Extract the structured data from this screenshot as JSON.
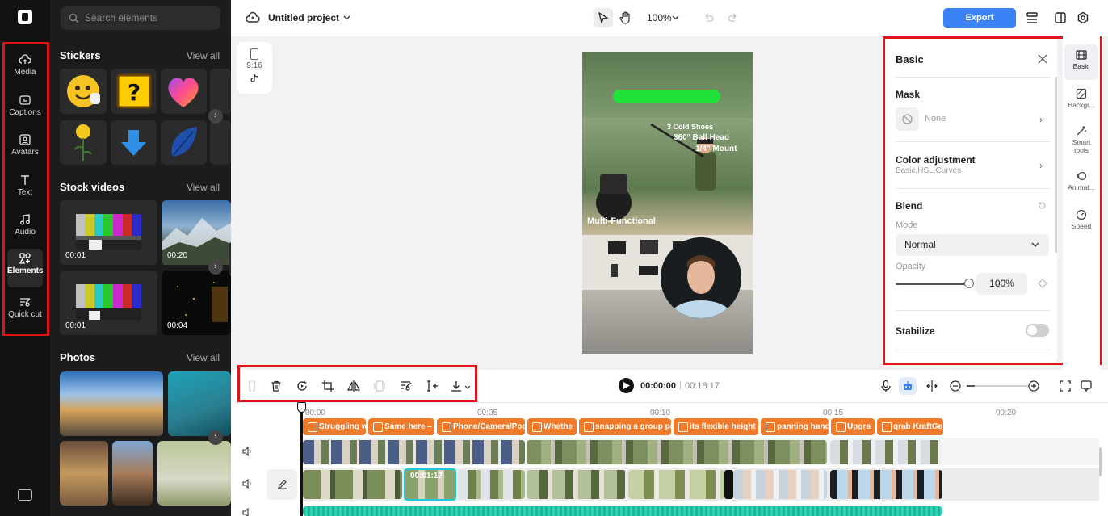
{
  "rail": {
    "items": [
      {
        "label": "Media",
        "icon": "cloud-upload-icon"
      },
      {
        "label": "Captions",
        "icon": "captions-icon"
      },
      {
        "label": "Avatars",
        "icon": "avatar-icon"
      },
      {
        "label": "Text",
        "icon": "text-icon"
      },
      {
        "label": "Audio",
        "icon": "music-note-icon"
      },
      {
        "label": "Elements",
        "icon": "elements-icon"
      },
      {
        "label": "Quick cut",
        "icon": "quick-cut-icon"
      }
    ],
    "active": "Elements"
  },
  "panel": {
    "search_placeholder": "Search elements",
    "stickers": {
      "title": "Stickers",
      "view_all": "View all"
    },
    "stock_videos": {
      "title": "Stock videos",
      "view_all": "View all",
      "durations": [
        "00:01",
        "00:20",
        "00:01",
        "00:04"
      ]
    },
    "photos": {
      "title": "Photos",
      "view_all": "View all"
    }
  },
  "header": {
    "project_name": "Untitled project",
    "zoom": "100%",
    "export_label": "Export"
  },
  "canvas": {
    "ratio": "9:16",
    "video_text": {
      "line1": "3 Cold Shoes",
      "line2": "360° Ball Head",
      "line3": "1/4\" Mount",
      "tagline": "Multi-Functional"
    }
  },
  "props": {
    "title": "Basic",
    "mask": {
      "label": "Mask",
      "value": "None"
    },
    "color": {
      "label": "Color adjustment",
      "sub": "Basic,HSL,Curves"
    },
    "blend": {
      "label": "Blend",
      "mode_label": "Mode",
      "mode_value": "Normal",
      "opacity_label": "Opacity",
      "opacity_value": "100%"
    },
    "stabilize": {
      "label": "Stabilize"
    }
  },
  "right_tabs": [
    {
      "label": "Basic",
      "icon": "film-icon"
    },
    {
      "label": "Backgr...",
      "icon": "background-icon"
    },
    {
      "label": "Smart tools",
      "icon": "magic-wand-icon"
    },
    {
      "label": "Animat...",
      "icon": "animation-icon"
    },
    {
      "label": "Speed",
      "icon": "speed-icon"
    }
  ],
  "toolbar": {
    "current_time": "00:00:00",
    "total_time": "00:18:17"
  },
  "timeline": {
    "ruler": [
      "00:00",
      "00:05",
      "00:10",
      "00:15",
      "00:20"
    ],
    "captions": [
      "Struggling w",
      "Same here –",
      "Phone/Camera/Pod",
      "Whethe",
      "snapping a group pi",
      "its flexible height",
      "panning hand",
      "Upgra",
      "grab KraftGe"
    ],
    "selected_clip_time": "00:01:17"
  },
  "colors": {
    "accent": "#3b82f6",
    "caption_clip": "#f07a2a",
    "highlight_box": "#e3121b",
    "sidebar": "#111111",
    "panel": "#1c1c1c"
  }
}
